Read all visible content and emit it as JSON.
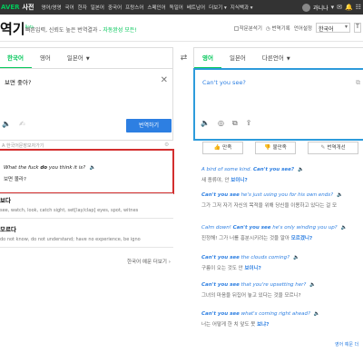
{
  "topnav": {
    "brand": "AVER",
    "dict_label": "사전",
    "links": [
      "영어/영영",
      "국어",
      "한자",
      "일본어",
      "중국어",
      "프랑스어",
      "스페인어",
      "독일어",
      "베트남어",
      "더보기 ▾",
      "지식백과 ▾"
    ],
    "user_name": "과니나",
    "user_suffix": "▾"
  },
  "header": {
    "logo": "역기",
    "logo_badge": "Beta",
    "tagline_prefix": "빠른입력, 신뢰도 높은 번역결과 - ",
    "tagline_accent": "자동완성 모든!",
    "options": [
      "작문분석기",
      "번역기록",
      "언어설정"
    ],
    "language_select": "한국어",
    "text_size_button": "T"
  },
  "source": {
    "tabs": [
      {
        "label": "한국어",
        "active": true
      },
      {
        "label": "영어",
        "active": false
      },
      {
        "label": "일본어",
        "active": false,
        "dropdown": true
      }
    ],
    "text": "보면 좋아?",
    "translate_button": "번역하기"
  },
  "target": {
    "tabs": [
      {
        "label": "영어",
        "active": true
      },
      {
        "label": "일본어",
        "active": false
      },
      {
        "label": "다른언어",
        "active": false,
        "dropdown": true
      }
    ],
    "text": "Can't you see?"
  },
  "feedback": {
    "good": "만족",
    "bad": "불만족",
    "modify": "번역개선"
  },
  "examples_left": {
    "header": "A 한국어문장모자가기",
    "highlight": {
      "en_pre": "What the fuck ",
      "en_bold": "do",
      "en_post": " you think it is?",
      "ko": "보면 몰라?"
    },
    "entries": [
      {
        "headword": "보다",
        "definition": "see, watch, look, catch sight, set[lay/clap] eyes, spot, witnes"
      },
      {
        "headword": "모르다",
        "definition": "do not know, do not understand; have no experience, be igno"
      }
    ],
    "more": "한국어 예문 더보기"
  },
  "examples_right": [
    {
      "en_pre": "A bird of some kind. ",
      "en_bold": "Can't you see?",
      "en_post": "",
      "ko_pre": "새 종류야, 안 ",
      "ko_bold": "보이니?",
      "ko_post": ""
    },
    {
      "en_pre": "",
      "en_bold": "Can't you see",
      "en_post": " he's just using you for his own ends?",
      "ko_pre": "그가 그저 자기 자신의 목적을 위해 당신을 이용하고 있다는 걸 모",
      "ko_bold": "",
      "ko_post": ""
    },
    {
      "en_pre": "Calm down! ",
      "en_bold": "Can't you see",
      "en_post": " he's only winding you up?",
      "ko_pre": "진정해! 그가 너를 흥분시키려는 것을 알아 ",
      "ko_bold": "모르겠니?",
      "ko_post": ""
    },
    {
      "en_pre": "",
      "en_bold": "Can't you see",
      "en_post": " the clouds coming?",
      "ko_pre": "구름이 오는 것도 안 ",
      "ko_bold": "보이니?",
      "ko_post": ""
    },
    {
      "en_pre": "",
      "en_bold": "Can't you see",
      "en_post": " that you're upsetting her?",
      "ko_pre": "그녀의 마음을 뒤집어 놓고 있다는 것을 모르니?",
      "ko_bold": "",
      "ko_post": ""
    },
    {
      "en_pre": "",
      "en_bold": "Can't you see",
      "en_post": " what's coming right ahead?",
      "ko_pre": "너는 어떻게 한 치 앞도 못 ",
      "ko_bold": "보냐?",
      "ko_post": ""
    }
  ],
  "examples_right_more": "영어 예문 더"
}
